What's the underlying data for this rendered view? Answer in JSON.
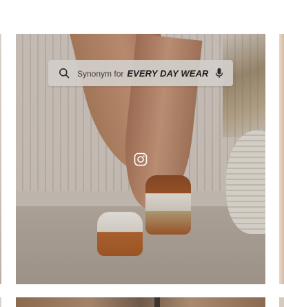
{
  "search": {
    "prefix": "Synonym for",
    "keyword": "EVERY DAY WEAR",
    "icon": "search-icon",
    "voice_icon": "microphone-icon"
  },
  "hero": {
    "badge_icon": "instagram-icon"
  },
  "colors": {
    "search_bg": "#d2cec8",
    "text": "#1f1f1f"
  }
}
